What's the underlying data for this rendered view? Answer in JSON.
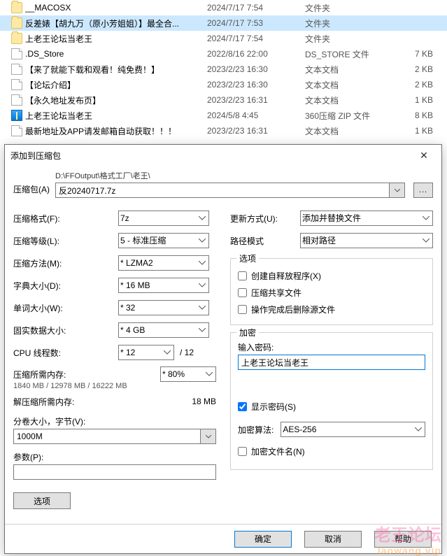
{
  "files": [
    {
      "name": "__MACOSX",
      "date": "2024/7/17 7:54",
      "type": "文件夹",
      "size": "",
      "icon": "folder",
      "sel": false
    },
    {
      "name": "反差婊【胡九万（原小芳姐姐）】最全合...",
      "date": "2024/7/17 7:53",
      "type": "文件夹",
      "size": "",
      "icon": "folder",
      "sel": true
    },
    {
      "name": "上老王论坛当老王",
      "date": "2024/7/17 7:54",
      "type": "文件夹",
      "size": "",
      "icon": "folder",
      "sel": false
    },
    {
      "name": ".DS_Store",
      "date": "2022/8/16 22:00",
      "type": "DS_STORE 文件",
      "size": "7 KB",
      "icon": "file",
      "sel": false
    },
    {
      "name": "【来了就能下载和观看！纯免费！】",
      "date": "2023/2/23 16:30",
      "type": "文本文档",
      "size": "2 KB",
      "icon": "file",
      "sel": false
    },
    {
      "name": "【论坛介绍】",
      "date": "2023/2/23 16:30",
      "type": "文本文档",
      "size": "2 KB",
      "icon": "file",
      "sel": false
    },
    {
      "name": "【永久地址发布页】",
      "date": "2023/2/23 16:31",
      "type": "文本文档",
      "size": "1 KB",
      "icon": "file",
      "sel": false
    },
    {
      "name": "上老王论坛当老王",
      "date": "2024/5/8 4:45",
      "type": "360压缩 ZIP 文件",
      "size": "8 KB",
      "icon": "zip",
      "sel": false
    },
    {
      "name": "最新地址及APP请发邮箱自动获取！！！",
      "date": "2023/2/23 16:31",
      "type": "文本文档",
      "size": "1 KB",
      "icon": "file",
      "sel": false
    }
  ],
  "dialog": {
    "title": "添加到压缩包",
    "path_label": "压缩包(A)",
    "path_dir": "D:\\FFOutput\\格式工厂\\老王\\",
    "path_file": "反20240717.7z",
    "browse": "...",
    "left": {
      "format_label": "压缩格式(F):",
      "format": "7z",
      "level_label": "压缩等级(L):",
      "level": "5 - 标准压缩",
      "method_label": "压缩方法(M):",
      "method": "* LZMA2",
      "dict_label": "字典大小(D):",
      "dict": "* 16 MB",
      "word_label": "单词大小(W):",
      "word": "* 32",
      "solid_label": "固实数据大小:",
      "solid": "* 4 GB",
      "cpu_label": "CPU 线程数:",
      "cpu": "* 12",
      "cpu_suffix": "/ 12",
      "mem_req_label": "压缩所需内存:",
      "mem_pct": "* 80%",
      "mem_req_sub": "1840 MB / 12978 MB / 16222 MB",
      "mem_decomp_label": "解压缩所需内存:",
      "mem_decomp_val": "18 MB",
      "split_label": "分卷大小，字节(V):",
      "split": "1000M",
      "params_label": "参数(P):",
      "params": "",
      "options_btn": "选项"
    },
    "right": {
      "update_label": "更新方式(U):",
      "update": "添加并替换文件",
      "pathmode_label": "路径模式",
      "pathmode": "相对路径",
      "options_group": "选项",
      "sfx": "创建自释放程序(X)",
      "share": "压缩共享文件",
      "delafter": "操作完成后删除源文件",
      "encrypt_group": "加密",
      "pw_label": "输入密码:",
      "pw_value": "上老王论坛当老王",
      "showpw": "显示密码(S)",
      "enc_method_label": "加密算法:",
      "enc_method": "AES-256",
      "enc_names": "加密文件名(N)"
    },
    "buttons": {
      "ok": "确定",
      "cancel": "取消",
      "help": "帮助"
    }
  },
  "watermark": {
    "line1": "老王论坛",
    "line2": "laowang.vip"
  }
}
